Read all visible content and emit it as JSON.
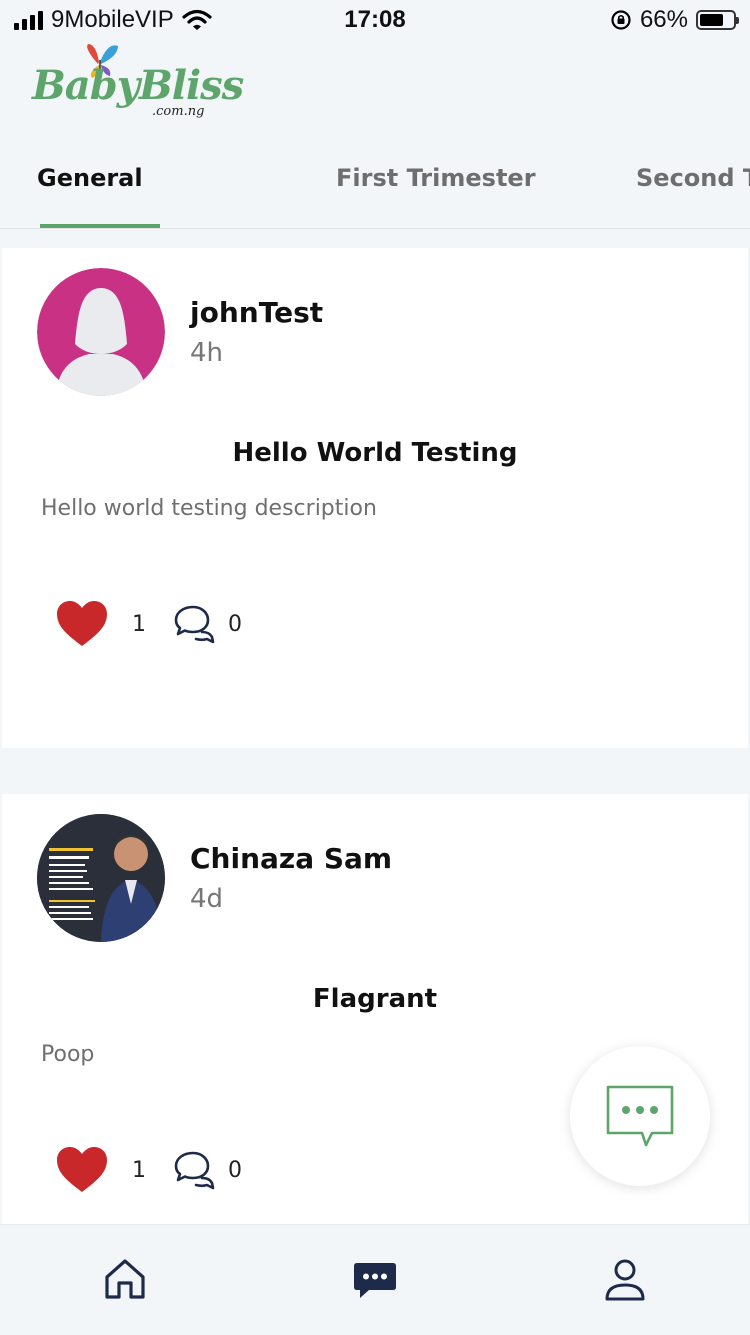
{
  "status_bar": {
    "carrier": "9MobileVIP",
    "time": "17:08",
    "battery_percent": "66%",
    "signal_bars": 4,
    "battery_level": 0.66
  },
  "logo": {
    "text": "BabyBliss",
    "sub": ".com.ng"
  },
  "tabs": [
    {
      "label": "General",
      "active": true
    },
    {
      "label": "First Trimester",
      "active": false
    },
    {
      "label": "Second T",
      "active": false
    }
  ],
  "posts": [
    {
      "username": "johnTest",
      "time": "4h",
      "title": "Hello World Testing",
      "description": "Hello world testing description",
      "likes": "1",
      "comments": "0",
      "avatar": "default-female-avatar"
    },
    {
      "username": "Chinaza Sam",
      "time": "4d",
      "title": "Flagrant",
      "description": "Poop",
      "likes": "1",
      "comments": "0",
      "avatar": "user-photo-avatar"
    }
  ],
  "fab": {
    "icon": "chat-bubble-icon"
  },
  "bottom_nav": [
    {
      "icon": "home-icon",
      "active": false
    },
    {
      "icon": "chat-icon",
      "active": true
    },
    {
      "icon": "profile-icon",
      "active": false
    }
  ],
  "colors": {
    "brand_green": "#5da56a",
    "like_red": "#c8282a",
    "nav_navy": "#1e2a4a",
    "avatar_pink": "#c93284"
  }
}
